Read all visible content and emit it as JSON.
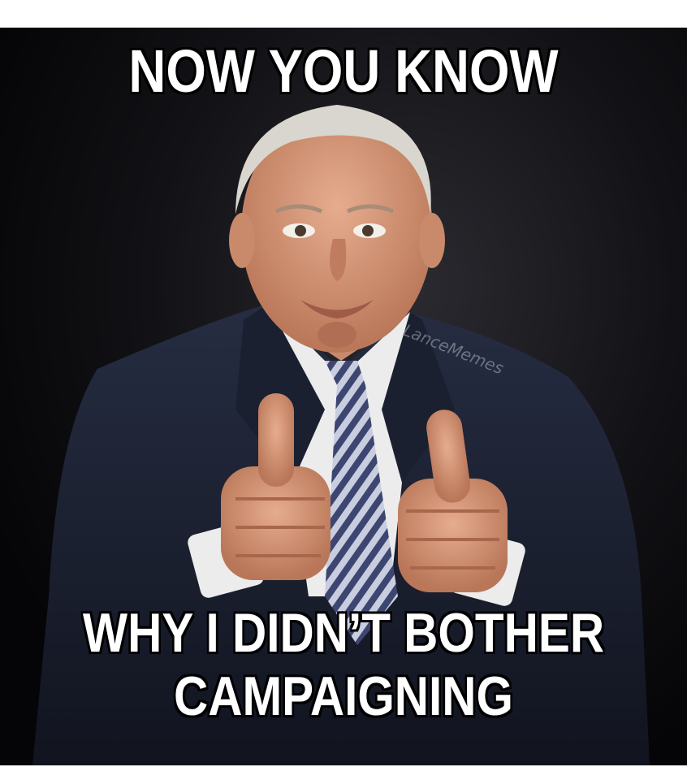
{
  "meme": {
    "top_text": "NOW YOU KNOW",
    "bottom_text_line1": "WHY I DIDN’T BOTHER",
    "bottom_text_line2": "CAMPAIGNING",
    "watermark": "LanceMemes"
  },
  "colors": {
    "background": "#0b0b0e",
    "suit": "#1c2233",
    "shirt": "#ececec",
    "skin": "#d69a7c",
    "caption_text": "#ffffff"
  }
}
